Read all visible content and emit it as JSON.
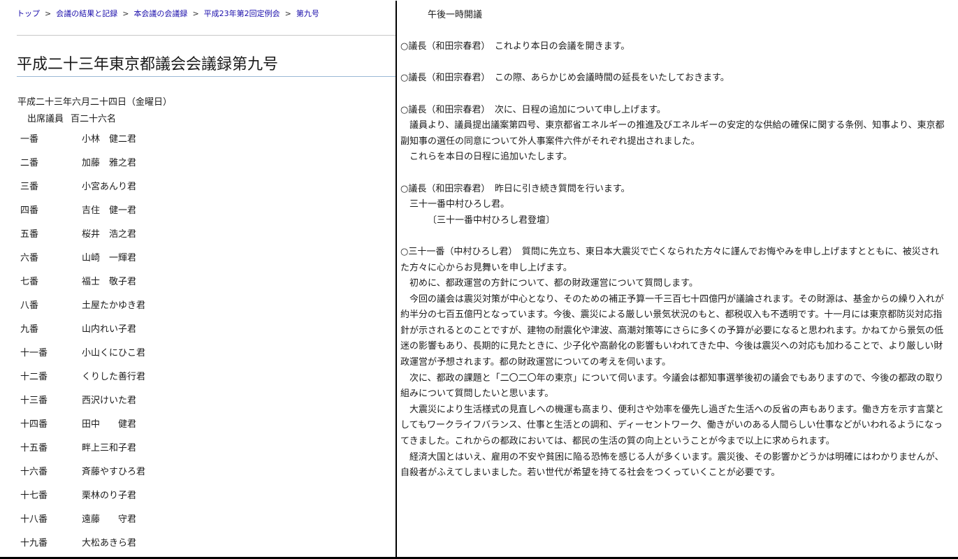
{
  "breadcrumb": {
    "items": [
      "トップ",
      "会議の結果と記録",
      "本会議の会議録",
      "平成23年第2回定例会",
      "第九号"
    ],
    "separator": ">"
  },
  "document": {
    "title": "平成二十三年東京都議会会議録第九号",
    "date": "平成二十三年六月二十四日（金曜日）",
    "attendance_label": "出席議員",
    "attendance_count": "百二十六名"
  },
  "members": [
    {
      "seat": "一番",
      "name": "小林　健二君"
    },
    {
      "seat": "二番",
      "name": "加藤　雅之君"
    },
    {
      "seat": "三番",
      "name": "小宮あんり君"
    },
    {
      "seat": "四番",
      "name": "吉住　健一君"
    },
    {
      "seat": "五番",
      "name": "桜井　浩之君"
    },
    {
      "seat": "六番",
      "name": "山崎　一輝君"
    },
    {
      "seat": "七番",
      "name": "福士　敬子君"
    },
    {
      "seat": "八番",
      "name": "土屋たかゆき君"
    },
    {
      "seat": "九番",
      "name": "山内れい子君"
    },
    {
      "seat": "十一番",
      "name": "小山くにひこ君"
    },
    {
      "seat": "十二番",
      "name": "くりした善行君"
    },
    {
      "seat": "十三番",
      "name": "西沢けいた君"
    },
    {
      "seat": "十四番",
      "name": "田中　　健君"
    },
    {
      "seat": "十五番",
      "name": "畔上三和子君"
    },
    {
      "seat": "十六番",
      "name": "斉藤やすひろ君"
    },
    {
      "seat": "十七番",
      "name": "栗林のり子君"
    },
    {
      "seat": "十八番",
      "name": "遠藤　　守君"
    },
    {
      "seat": "十九番",
      "name": "大松あきら君"
    }
  ],
  "minutes": [
    {
      "type": "opening",
      "text": "午後一時開議"
    },
    {
      "type": "gap"
    },
    {
      "type": "speech",
      "text": "○議長（和田宗春君）　これより本日の会議を開きます。"
    },
    {
      "type": "gap"
    },
    {
      "type": "speech",
      "text": "○議長（和田宗春君）　この際、あらかじめ会議時間の延長をいたしておきます。"
    },
    {
      "type": "gap"
    },
    {
      "type": "speech",
      "text": "○議長（和田宗春君）　次に、日程の追加について申し上げます。"
    },
    {
      "type": "indent1",
      "text": "議員より、議員提出議案第四号、東京都省エネルギーの推進及びエネルギーの安定的な供給の確保に関する条例、知事より、東京都副知事の選任の同意について外人事案件六件がそれぞれ提出されました。"
    },
    {
      "type": "indent1",
      "text": "これらを本日の日程に追加いたします。"
    },
    {
      "type": "gap"
    },
    {
      "type": "speech",
      "text": "○議長（和田宗春君）　昨日に引き続き質問を行います。"
    },
    {
      "type": "indent1",
      "text": "三十一番中村ひろし君。"
    },
    {
      "type": "indent3",
      "text": "〔三十一番中村ひろし君登壇〕"
    },
    {
      "type": "gap"
    },
    {
      "type": "speech",
      "text": "○三十一番（中村ひろし君）　質問に先立ち、東日本大震災で亡くなられた方々に謹んでお悔やみを申し上げますとともに、被災された方々に心からお見舞いを申し上げます。"
    },
    {
      "type": "indent1",
      "text": "初めに、都政運営の方針について、都の財政運営について質問します。"
    },
    {
      "type": "indent1",
      "text": "今回の議会は震災対策が中心となり、そのための補正予算一千三百七十四億円が議論されます。その財源は、基金からの繰り入れが約半分の七百五億円となっています。今後、震災による厳しい景気状況のもと、都税収入も不透明です。十一月には東京都防災対応指針が示されるとのことですが、建物の耐震化や津波、高潮対策等にさらに多くの予算が必要になると思われます。かねてから景気の低迷の影響もあり、長期的に見たときに、少子化や高齢化の影響もいわれてきた中、今後は震災への対応も加わることで、より厳しい財政運営が予想されます。都の財政運営についての考えを伺います。"
    },
    {
      "type": "indent1",
      "text": "次に、都政の課題と「二〇二〇年の東京」について伺います。今議会は都知事選挙後初の議会でもありますので、今後の都政の取り組みについて質問したいと思います。"
    },
    {
      "type": "indent1",
      "text": "大震災により生活様式の見直しへの機運も高まり、便利さや効率を優先し過ぎた生活への反省の声もあります。働き方を示す言葉としてもワークライフバランス、仕事と生活との調和、ディーセントワーク、働きがいのある人間らしい仕事などがいわれるようになってきました。これからの都政においては、都民の生活の質の向上ということが今まで以上に求められます。"
    },
    {
      "type": "indent1",
      "text": "経済大国とはいえ、雇用の不安や貧困に陥る恐怖を感じる人が多くいます。震災後、その影響かどうかは明確にはわかりませんが、自殺者がふえてしまいました。若い世代が希望を持てる社会をつくっていくことが必要です。"
    }
  ]
}
